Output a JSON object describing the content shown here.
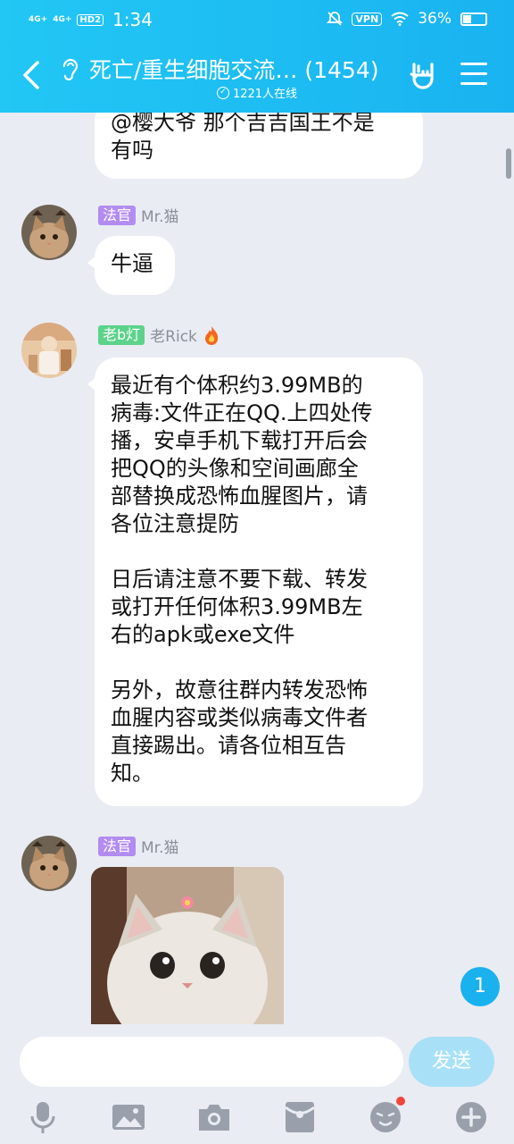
{
  "status_bar": {
    "net1": "4G+",
    "net2": "4G+",
    "hd": "HD2",
    "time": "1:34",
    "vpn": "VPN",
    "battery": "36%"
  },
  "header": {
    "title": "死亡/重生细胞交流… (1454)",
    "online": "1221人在线"
  },
  "messages": [
    {
      "text": "@樱大爷 那个吉吉国王不是\n有吗"
    },
    {
      "tag": "法官",
      "name": "Mr.猫",
      "text": "牛逼"
    },
    {
      "tag": "老b灯",
      "name": "老Rick",
      "text": "最近有个体积约3.99MB的\n病毒:文件正在QQ.上四处传\n播，安卓手机下载打开后会\n把QQ的头像和空间画廊全\n部替换成恐怖血腥图片，请\n各位注意提防\n\n日后请注意不要下载、转发\n或打开任何体积3.99MB左\n右的apk或exe文件\n\n另外，故意往群内转发恐怖\n血腥内容或类似病毒文件者\n直接踢出。请各位相互告\n知。"
    },
    {
      "tag": "法官",
      "name": "Mr.猫"
    }
  ],
  "unread_count": "1",
  "input": {
    "placeholder": "",
    "send_label": "发送"
  },
  "colors": {
    "header": "#1ab8f2",
    "background": "#e9ecf2",
    "tag_purple": "#b28cf0",
    "tag_green": "#5bd38a"
  },
  "toolbar_icons": [
    "microphone-icon",
    "image-icon",
    "camera-icon",
    "red-packet-icon",
    "emoji-icon",
    "plus-icon"
  ]
}
